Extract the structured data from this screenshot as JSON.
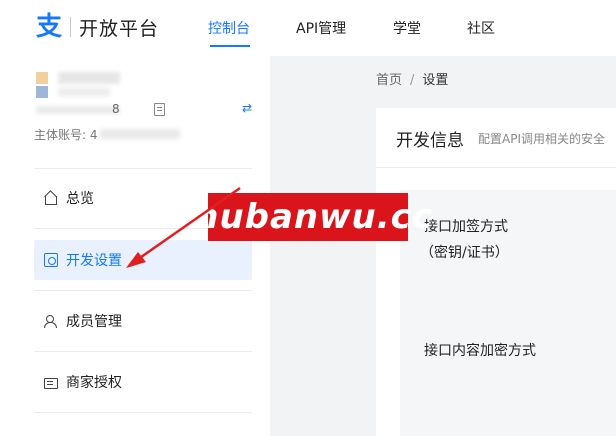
{
  "header": {
    "logo_mark": "支",
    "logo_text": "开放平台",
    "nav": [
      {
        "label": "控制台",
        "active": true
      },
      {
        "label": "API管理",
        "active": false
      },
      {
        "label": "学堂",
        "active": false
      },
      {
        "label": "社区",
        "active": false
      }
    ]
  },
  "sidebar": {
    "account_id_tail": "8",
    "account_label": "主体账号: 4",
    "menu": [
      {
        "label": "总览",
        "icon": "home-icon",
        "active": false
      },
      {
        "label": "开发设置",
        "icon": "settings-icon",
        "active": true
      },
      {
        "label": "成员管理",
        "icon": "members-icon",
        "active": false
      },
      {
        "label": "商家授权",
        "icon": "merchant-icon",
        "active": false
      }
    ]
  },
  "main": {
    "breadcrumb": {
      "home": "首页",
      "separator": "/",
      "current": "设置"
    },
    "card": {
      "title": "开发信息",
      "description": "配置API调用相关的安全",
      "fields": [
        {
          "label_line1": "接口加签方式",
          "label_line2": "（密钥/证书）"
        },
        {
          "label_line1": "接口内容加密方式"
        }
      ]
    }
  },
  "watermark": {
    "text": "mubanwu.cc",
    "color": "#d9141b"
  },
  "colors": {
    "accent": "#1677ff",
    "active_bg": "#e8f1fd",
    "arrow": "#e02020"
  }
}
